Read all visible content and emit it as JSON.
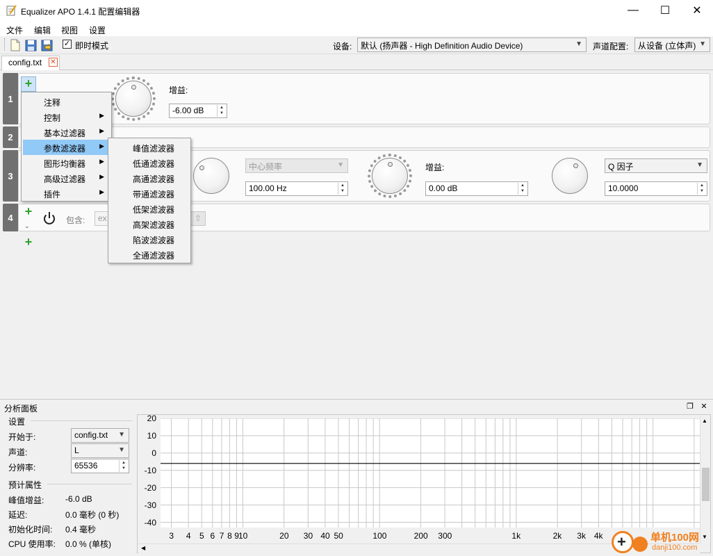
{
  "window": {
    "title": "Equalizer APO 1.4.1 配置编辑器",
    "minimize_glyph": "—",
    "maximize_glyph": "☐",
    "close_glyph": "✕"
  },
  "menu": [
    "文件",
    "编辑",
    "视图",
    "设置"
  ],
  "toolbar": {
    "icons": [
      "new-file-icon",
      "save-icon",
      "save-as-icon"
    ],
    "realtime_mode_label": "即时模式",
    "realtime_mode_checked": true,
    "device_label": "设备:",
    "device_value": "默认 (扬声器 - High Definition Audio Device)",
    "channel_config_label": "声道配置:",
    "channel_config_value": "从设备 (立体声)"
  },
  "tabs": [
    {
      "label": "config.txt",
      "close_glyph": "✕"
    }
  ],
  "rows": [
    {
      "number": "1",
      "gain_label": "增益:",
      "gain_value": "-6.00 dB"
    },
    {
      "number": "2"
    },
    {
      "number": "3",
      "freq_placeholder": "中心频率",
      "freq_value": "100.00 Hz",
      "gain_label": "增益:",
      "gain_value": "0.00 dB",
      "q_label": "Q 因子",
      "q_value": "10.0000"
    },
    {
      "number": "4",
      "include_label": "包含:",
      "include_value": "ex"
    }
  ],
  "context_menu": {
    "items": [
      "注释",
      "控制",
      "基本过滤器",
      "参数滤波器",
      "图形均衡器",
      "高级过滤器",
      "插件"
    ],
    "has_submenu": [
      false,
      true,
      true,
      true,
      true,
      true,
      true
    ],
    "highlighted_index": 3,
    "submenu_glyph": "▶"
  },
  "submenu": {
    "items": [
      "峰值滤波器",
      "低通滤波器",
      "高通滤波器",
      "带通滤波器",
      "低架滤波器",
      "高架滤波器",
      "陷波滤波器",
      "全通滤波器"
    ]
  },
  "analysis": {
    "title": "分析面板",
    "settings_title": "设置",
    "start_at_label": "开始于:",
    "start_at_value": "config.txt",
    "channel_label": "声道:",
    "channel_value": "L",
    "resolution_label": "分辨率:",
    "resolution_value": "65536",
    "estimated_title": "预计属性",
    "peak_gain_label": "峰值增益:",
    "peak_gain_value": "-6.0 dB",
    "latency_label": "延迟:",
    "latency_value": "0.0 毫秒 (0 秒)",
    "init_time_label": "初始化时间:",
    "init_time_value": "0.4 毫秒",
    "cpu_label": "CPU 使用率:",
    "cpu_value": "0.0 % (单核)"
  },
  "chart_data": {
    "type": "line",
    "title": "",
    "xlabel": "",
    "ylabel": "",
    "x_scale": "log",
    "xlim": [
      2.5,
      22000
    ],
    "ylim": [
      -43,
      20
    ],
    "y_ticks": [
      20,
      10,
      0,
      -10,
      -20,
      -30,
      -40
    ],
    "x_ticks": [
      3,
      4,
      5,
      6,
      7,
      8,
      9,
      10,
      20,
      30,
      40,
      50,
      100,
      200,
      300,
      1000,
      2000,
      3000,
      4000
    ],
    "x_tick_labels": [
      "3",
      "4",
      "5",
      "6",
      "7",
      "8",
      "9",
      "10",
      "20",
      "30",
      "40",
      "50",
      "100",
      "200",
      "300",
      "1k",
      "2k",
      "3k",
      "4k"
    ],
    "grid": true,
    "series": [
      {
        "x": [
          2.5,
          22000
        ],
        "y": [
          -6,
          -6
        ]
      }
    ]
  },
  "watermark": {
    "text1": "单机100网",
    "text2": "danji100.com"
  }
}
